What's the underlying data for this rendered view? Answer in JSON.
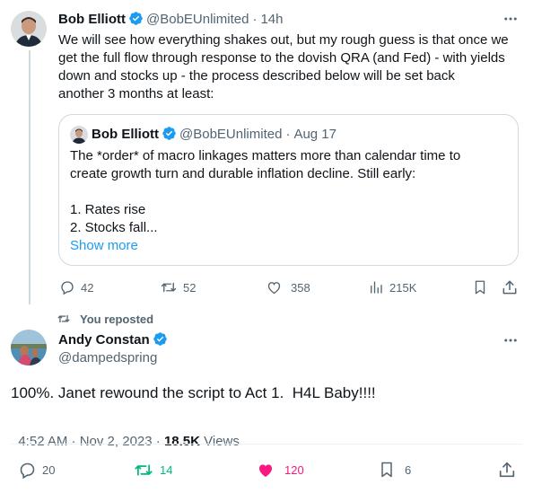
{
  "parent_tweet": {
    "author_name": "Bob Elliott",
    "handle": "@BobEUnlimited",
    "separator": "·",
    "time": "14h",
    "lines": [
      "We will see how everything shakes out, but my rough guess is that once we",
      "get the full flow through response to the dovish QRA (and Fed) - with yields",
      "down and stocks up - the process described below will be set back",
      "another 3 months at least:"
    ],
    "quote": {
      "author_name": "Bob Elliott",
      "handle": "@BobEUnlimited",
      "separator": "·",
      "date": "Aug 17",
      "lines": [
        "The *order* of macro linkages matters more than calendar time to",
        "create growth turn and durable inflation decline. Still early:",
        "",
        "1. Rates rise",
        "2. Stocks fall..."
      ],
      "show_more": "Show more"
    },
    "actions": {
      "replies": "42",
      "reposts": "52",
      "likes": "358",
      "views": "215K"
    }
  },
  "repost_banner": "You reposted",
  "main_tweet": {
    "author_name": "Andy Constan",
    "handle": "@dampedspring",
    "text": "100%. Janet rewound the script to Act 1.  H4L Baby!!!!",
    "timestamp": "4:52 AM · Nov 2, 2023 · ",
    "views_count": "18.5K",
    "views_label": " Views",
    "actions": {
      "replies": "20",
      "reposts": "14",
      "likes": "120",
      "bookmarks": "6"
    }
  },
  "colors": {
    "verified_blue": "#1d9bf0",
    "repost_green": "#00ba7c",
    "like_pink": "#f91880",
    "muted": "#536471"
  },
  "icons": [
    "verified-badge-icon",
    "more-icon",
    "reply-icon",
    "repost-icon",
    "like-icon",
    "views-icon",
    "bookmark-icon",
    "share-icon"
  ]
}
